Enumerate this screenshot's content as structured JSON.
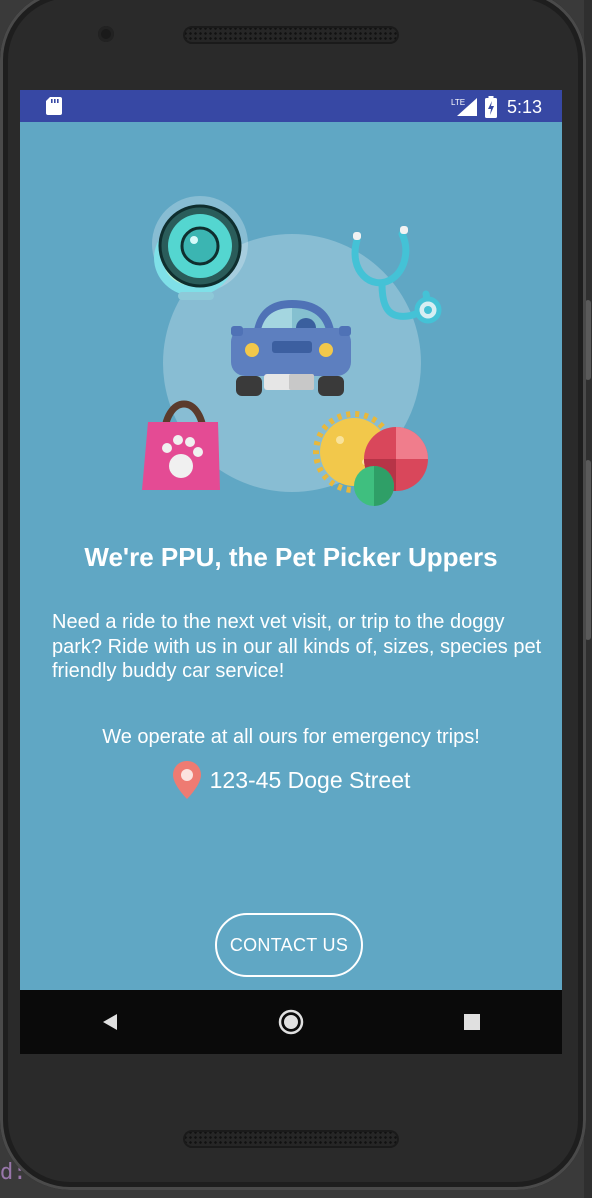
{
  "ide": {
    "code_fragment": "d:"
  },
  "status_bar": {
    "network_label": "LTE",
    "time": "5:13",
    "icons": [
      "sd-card-icon",
      "signal-icon",
      "battery-icon"
    ]
  },
  "illustration": {
    "icons": [
      "fishbowl-icon",
      "stethoscope-icon",
      "car-icon",
      "pet-bag-icon",
      "pet-toys-icon"
    ]
  },
  "headline": "We're PPU, the Pet Picker Uppers",
  "body": "Need a ride to the next vet visit, or trip to the doggy park? Ride with us in our all kinds of, sizes, species pet friendly buddy car service!",
  "hours": "We operate at all ours for emergency trips!",
  "address": {
    "icon": "location-pin-icon",
    "text": "123-45 Doge Street"
  },
  "contact_button": {
    "label": "CONTACT US"
  },
  "nav_bar": {
    "icons": [
      "back-icon",
      "home-icon",
      "recents-icon"
    ]
  },
  "colors": {
    "screen_bg": "#60a7c4",
    "status_bar": "#3748a4",
    "nav_bar": "#0a0a0a",
    "text": "#ffffff"
  }
}
